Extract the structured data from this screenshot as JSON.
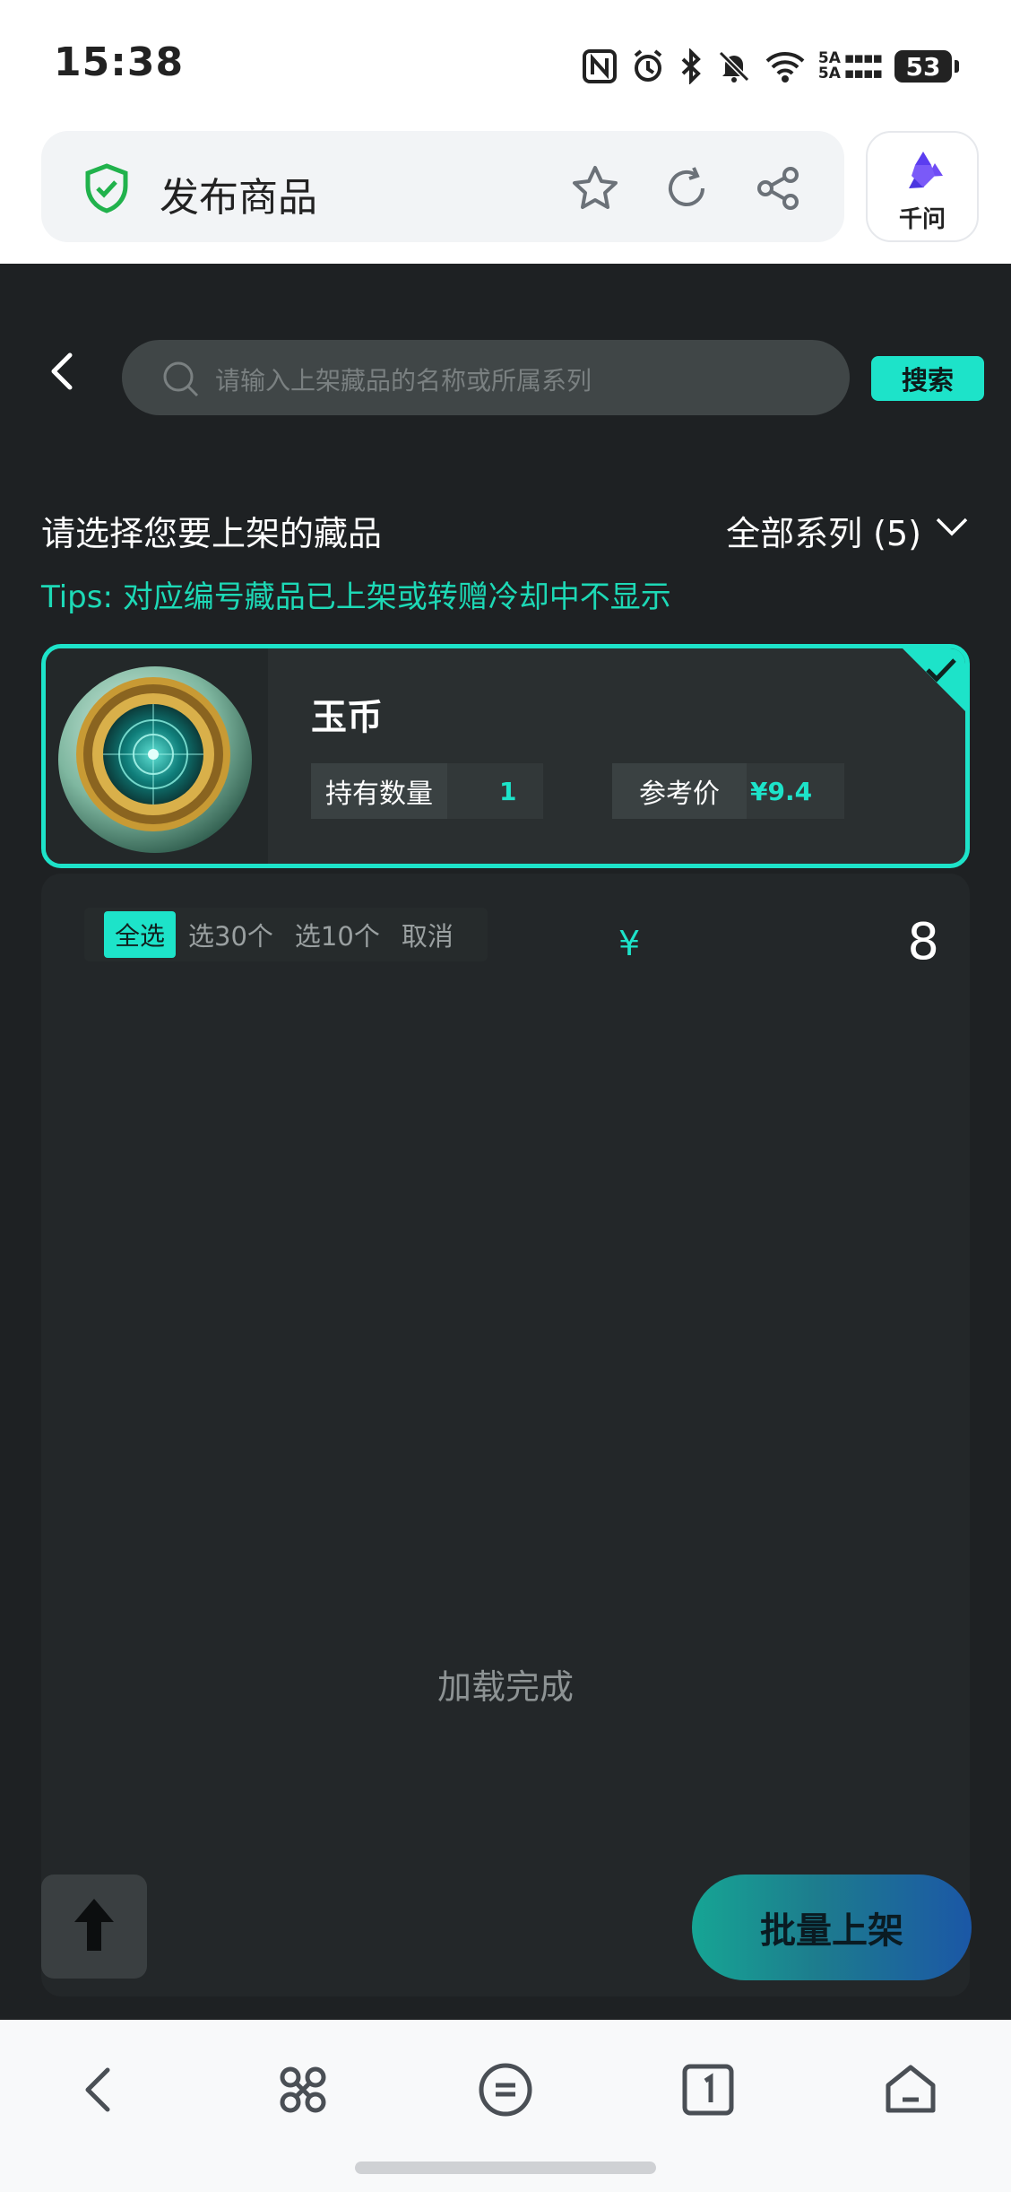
{
  "status_bar": {
    "time": "15:38",
    "network_label": "5A\n5A",
    "battery_level": "53",
    "icons": [
      "nfc-icon",
      "alarm-icon",
      "bluetooth-icon",
      "mute-icon",
      "wifi-icon",
      "signal-icon",
      "battery-icon"
    ]
  },
  "browser": {
    "page_title": "发布商品",
    "assistant_label": "千问",
    "icons": [
      "shield-check-icon",
      "star-icon",
      "refresh-icon",
      "share-icon",
      "qianwen-logo-icon"
    ]
  },
  "search": {
    "placeholder": "请输入上架藏品的名称或所属系列",
    "button_label": "搜索"
  },
  "section": {
    "title": "请选择您要上架的藏品",
    "series_filter": "全部系列 (5)",
    "tips": "Tips:  对应编号藏品已上架或转赠冷却中不显示"
  },
  "product": {
    "name": "玉币",
    "quantity_label": "持有数量",
    "quantity_value": "1",
    "price_label": "参考价",
    "price_value": "¥9.4",
    "selected": true
  },
  "selection": {
    "select_all": "全选",
    "select_30": "选30个",
    "select_10": "选10个",
    "cancel": "取消",
    "currency_symbol": "¥",
    "price_input": "8"
  },
  "list_status": "加载完成",
  "actions": {
    "batch_list": "批量上架"
  },
  "colors": {
    "accent": "#1de3c9",
    "page_bg": "#1e2123",
    "card_bg": "#2a2f30"
  }
}
